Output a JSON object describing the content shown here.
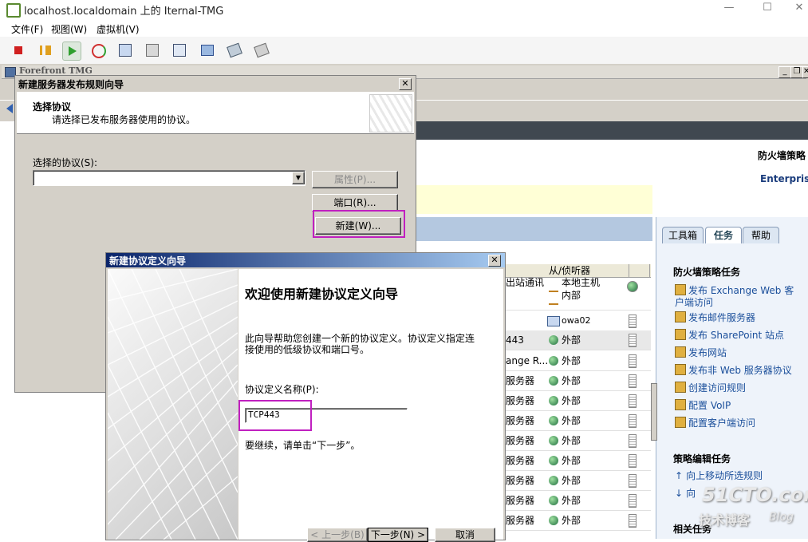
{
  "host": {
    "title": "localhost.localdomain 上的 Iternal-TMG",
    "menu": [
      "文件(F)",
      "视图(W)",
      "虚拟机(V)"
    ]
  },
  "vm": {
    "app_title": "Forefront TMG",
    "header_title": "防火墙策略",
    "header_subtitle": "Enterprise"
  },
  "dialog1": {
    "title": "新建服务器发布规则向导",
    "heading": "选择协议",
    "subheading": "请选择已发布服务器使用的协议。",
    "protocol_label": "选择的协议(S):",
    "protocol_value": "",
    "properties_button": "属性(P)...",
    "ports_button": "端口(R)...",
    "new_button": "新建(W)..."
  },
  "dialog2": {
    "title": "新建协议定义向导",
    "welcome": "欢迎使用新建协议定义向导",
    "description": "此向导帮助您创建一个新的协议定义。协议定义指定连接使用的低级协议和端口号。",
    "name_label": "协议定义名称(P):",
    "name_value": "TCP443",
    "continue_text": "要继续，请单击“下一步”。",
    "back_button": "< 上一步(B)",
    "next_button": "下一步(N) >",
    "cancel_button": "取消"
  },
  "grid": {
    "col_from": "从/侦听器",
    "rows": [
      {
        "left": "出站通讯",
        "from": [
          "本地主机",
          "内部"
        ]
      },
      {
        "left": "",
        "from": [
          "owa02"
        ]
      },
      {
        "left": "443",
        "from": [
          "外部"
        ]
      },
      {
        "left": "ange R...",
        "from": [
          "外部"
        ]
      },
      {
        "left": "服务器",
        "from": [
          "外部"
        ]
      },
      {
        "left": "服务器",
        "from": [
          "外部"
        ]
      },
      {
        "left": "服务器",
        "from": [
          "外部"
        ]
      },
      {
        "left": "服务器",
        "from": [
          "外部"
        ]
      },
      {
        "left": "服务器",
        "from": [
          "外部"
        ]
      },
      {
        "left": "服务器",
        "from": [
          "外部"
        ]
      },
      {
        "left": "服务器",
        "from": [
          "外部"
        ]
      },
      {
        "left": "服务器",
        "from": [
          "外部"
        ]
      }
    ]
  },
  "taskpane": {
    "tabs": [
      "工具箱",
      "任务",
      "帮助"
    ],
    "section1": "防火墙策略任务",
    "tasks": [
      "发布 Exchange Web 客户端访问",
      "发布邮件服务器",
      "发布 SharePoint 站点",
      "发布网站",
      "发布非 Web 服务器协议",
      "创建访问规则",
      "配置 VoIP",
      "配置客户端访问"
    ],
    "section2": "策略编辑任务",
    "edit_tasks": [
      "向上移动所选规则",
      "向"
    ],
    "section3": "相关任务"
  },
  "watermark": {
    "site": "51CTO.com",
    "text": "技术博客",
    "blog": "Blog"
  }
}
